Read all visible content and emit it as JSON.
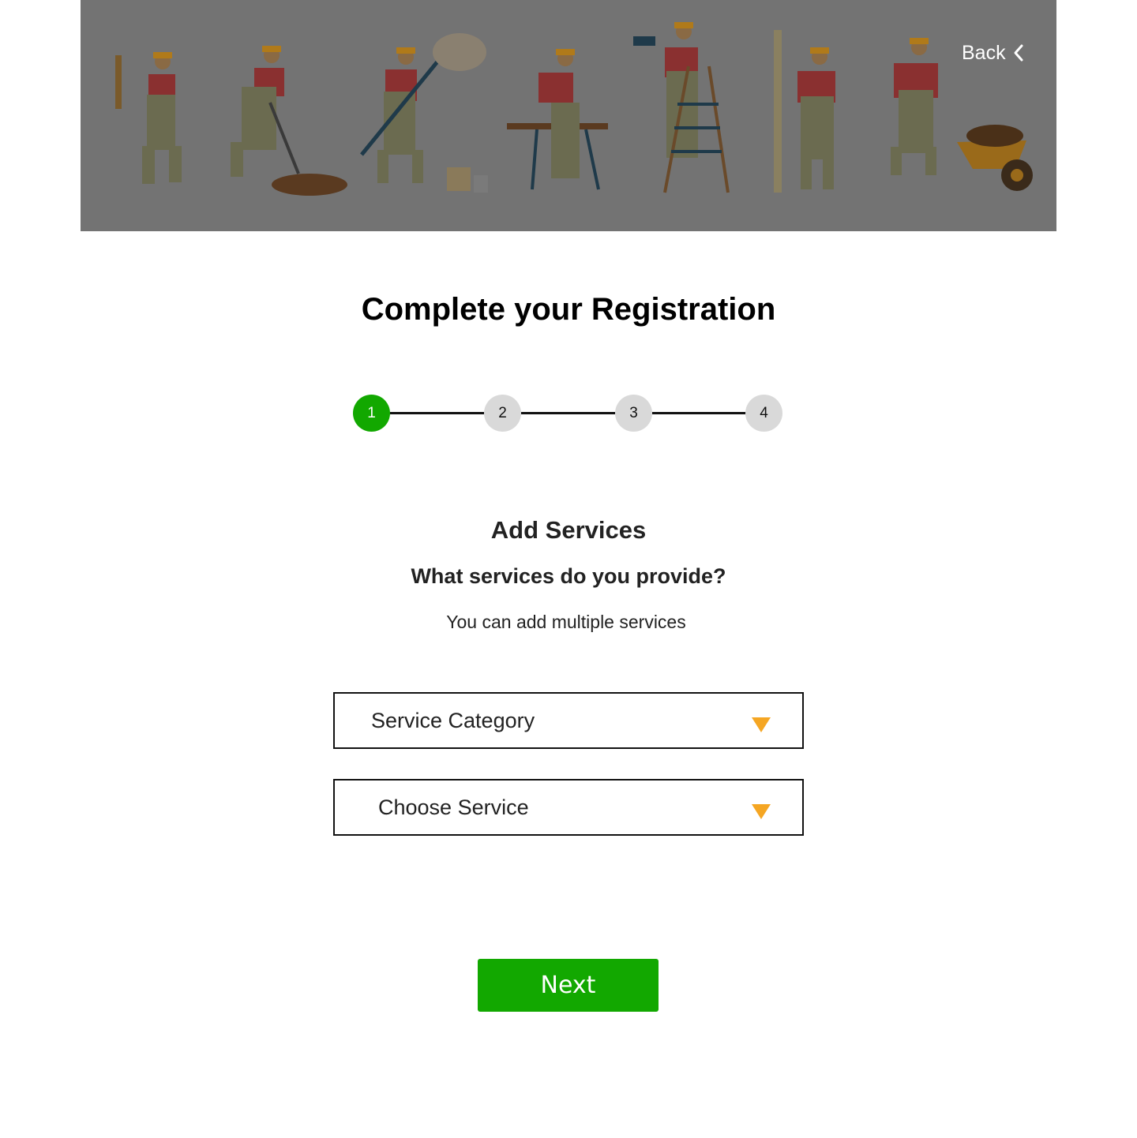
{
  "header": {
    "back_label": "Back",
    "back_icon": "chevron-left-icon",
    "illustration": "construction-workers-banner"
  },
  "page": {
    "title": "Complete your Registration"
  },
  "stepper": {
    "steps": [
      "1",
      "2",
      "3",
      "4"
    ],
    "active_step": 1
  },
  "section": {
    "title": "Add Services",
    "question": "What services do you provide?",
    "hint": "You can add multiple services"
  },
  "form": {
    "service_category_placeholder": "Service Category",
    "choose_service_placeholder": "Choose Service",
    "dropdown_icon": "triangle-down-icon"
  },
  "actions": {
    "next_label": "Next"
  },
  "colors": {
    "primary_green": "#12a800",
    "accent_orange": "#f5a623",
    "banner_overlay": "#737373",
    "step_inactive": "#d9d9d9"
  }
}
